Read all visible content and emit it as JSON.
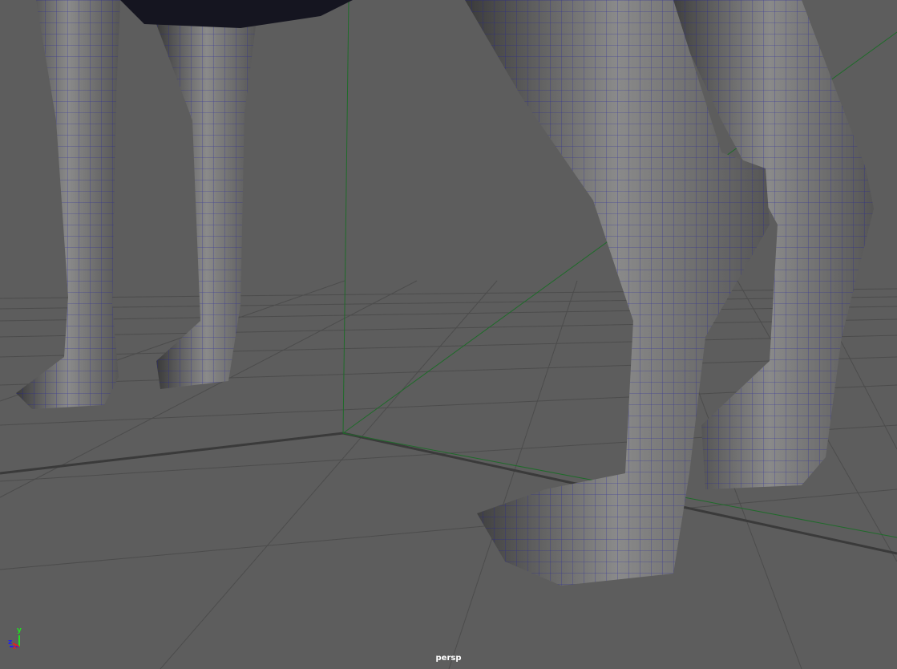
{
  "viewport": {
    "camera_label": "persp",
    "background_color": "#5d5d5d",
    "wireframe_color": "#1a1aa0",
    "axis_gizmo": {
      "y": "y",
      "x": "x",
      "z": "z",
      "y_color": "#22dd22",
      "x_color": "#dd2222",
      "z_color": "#2222ee"
    }
  }
}
